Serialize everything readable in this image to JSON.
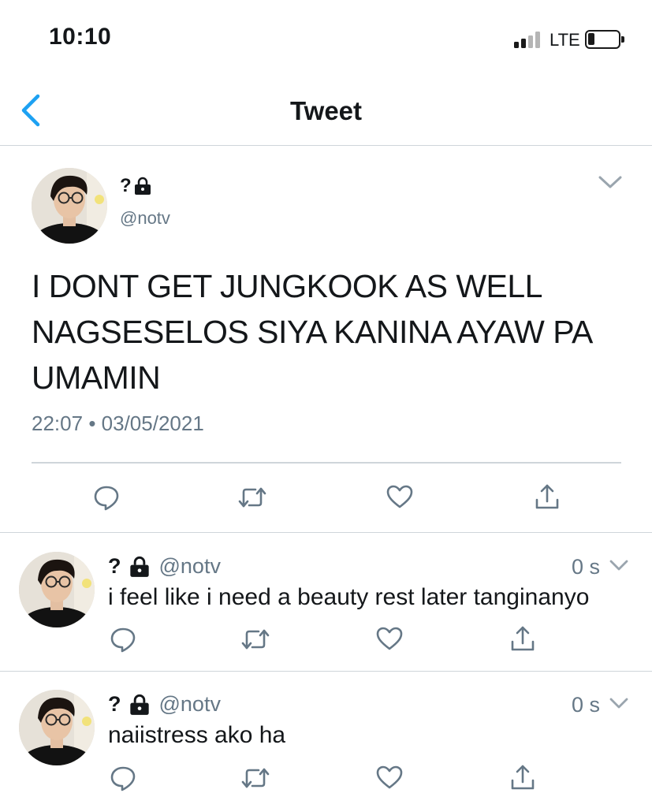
{
  "status_bar": {
    "time": "10:10",
    "network": "LTE",
    "battery_level": 0.2
  },
  "nav": {
    "title": "Tweet",
    "back_icon": "chevron-left-icon"
  },
  "main_tweet": {
    "name": "?",
    "lock_icon": "lock-icon",
    "handle": "@notv",
    "text_lines": [
      "I DONT GET JUNGKOOK AS WELL",
      "NAGSESELOS SIYA KANINA AYAW PA",
      "UMAMIN"
    ],
    "time": "22:07",
    "separator": "•",
    "date": "03/05/2021",
    "actions": [
      "reply-icon",
      "retweet-icon",
      "like-icon",
      "share-icon"
    ]
  },
  "replies": [
    {
      "name": "?",
      "handle": "@notv",
      "time": "0 s",
      "text": "i feel like i need a beauty rest later tanginanyo"
    },
    {
      "name": "?",
      "handle": "@notv",
      "time": "0 s",
      "text": "naiistress ako ha"
    }
  ],
  "colors": {
    "accent": "#1da1f2",
    "text": "#14171a",
    "secondary": "#657786",
    "divider": "#cfd5da"
  }
}
